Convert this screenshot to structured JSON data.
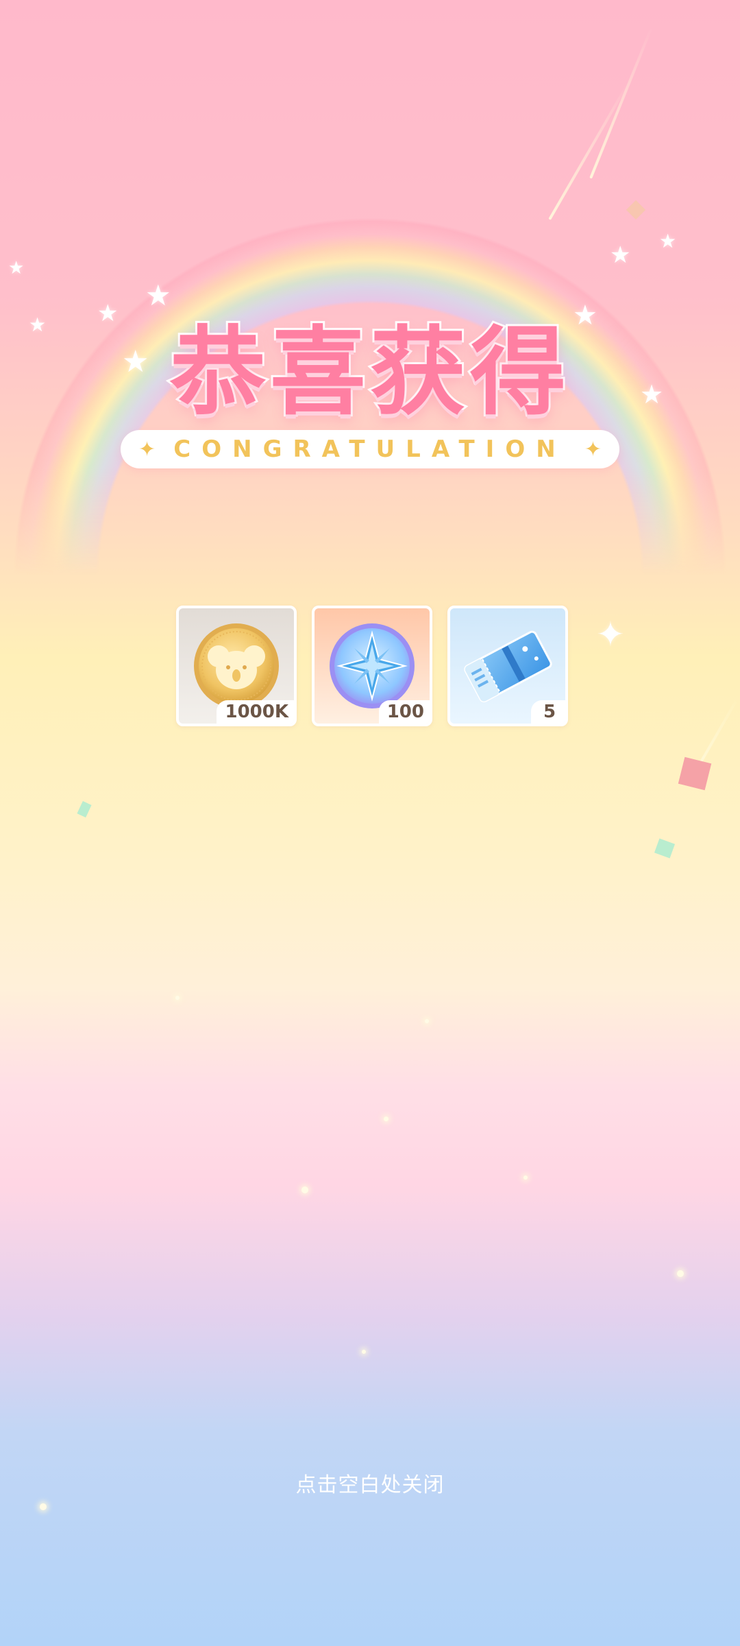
{
  "title": "恭喜获得",
  "subtitle": "CONGRATULATION",
  "rewards": [
    {
      "name": "koala-coin",
      "icon": "koala-gold-coin-icon",
      "quantity": "1000K"
    },
    {
      "name": "star-medal",
      "icon": "blue-star-medal-icon",
      "quantity": "100"
    },
    {
      "name": "ticket",
      "icon": "blue-ticket-icon",
      "quantity": "5"
    }
  ],
  "close_hint": "点击空白处关闭",
  "colors": {
    "title": "#ff7fa2",
    "subtitle": "#f2c35a",
    "badge_text": "#6b5546"
  }
}
